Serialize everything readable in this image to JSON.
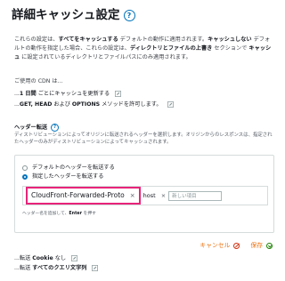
{
  "header": {
    "title": "詳細キャッシュ設定",
    "help_symbol": "?"
  },
  "description": {
    "p1": "これらの設定は、",
    "b1": "すべてをキャッシュする",
    "p2": " デフォルトの動作に適用されます。",
    "b2": "キャッシュしない",
    "p3": " デフォルトの動作を指定した場合、これらの設定は、",
    "b3": "ディレクトリとファイルの上書き",
    "p4": " セクションで ",
    "b4": "キャッシュ",
    "p5": " に設定されているディレクトリとファイルパスにのみ適用されます。"
  },
  "cdn_label": "ご使用の CDN は...",
  "settings": {
    "line1_prefix": "...",
    "line1_bold": "1 日間",
    "line1_suffix": " ごとにキャッシュを更新する",
    "line2_prefix": "...",
    "line2_bold1": "GET, HEAD",
    "line2_mid": " および ",
    "line2_bold2": "OPTIONS",
    "line2_suffix": " メソッドを許可します。"
  },
  "header_forwarding": {
    "label": "ヘッダー転送",
    "help_symbol": "?",
    "description": "ディストリビューションによってオリジンに転送されるヘッダーを選択します。オリジンからのレスポンスは、指定されたヘッダーのみがディストリビューションによってキャッシュされます。",
    "radio_default": "デフォルトのヘッダーを転送する",
    "radio_specified": "指定したヘッダーを転送する",
    "selected": "指定したヘッダーを転送する",
    "tag1": "CloudFront-Forwarded-Proto",
    "tag2": "host",
    "tag_remove": "×",
    "new_item_placeholder": "新しい項目",
    "hint_prefix": "ヘッダー名を追加して、",
    "hint_key": "Enter",
    "hint_suffix": " を押す"
  },
  "actions": {
    "cancel": "キャンセル",
    "save": "保存"
  },
  "forwarding": {
    "cookie_prefix": "...転送 ",
    "cookie_bold": "Cookie",
    "cookie_suffix": " なし",
    "query_prefix": "...転送 ",
    "query_bold": "すべてのクエリ文字列"
  },
  "colors": {
    "link_blue": "#0073bb",
    "highlight_pink": "#e8247a",
    "action_orange": "#ec7211",
    "cancel_red": "#d13212",
    "save_green": "#1d8102"
  }
}
